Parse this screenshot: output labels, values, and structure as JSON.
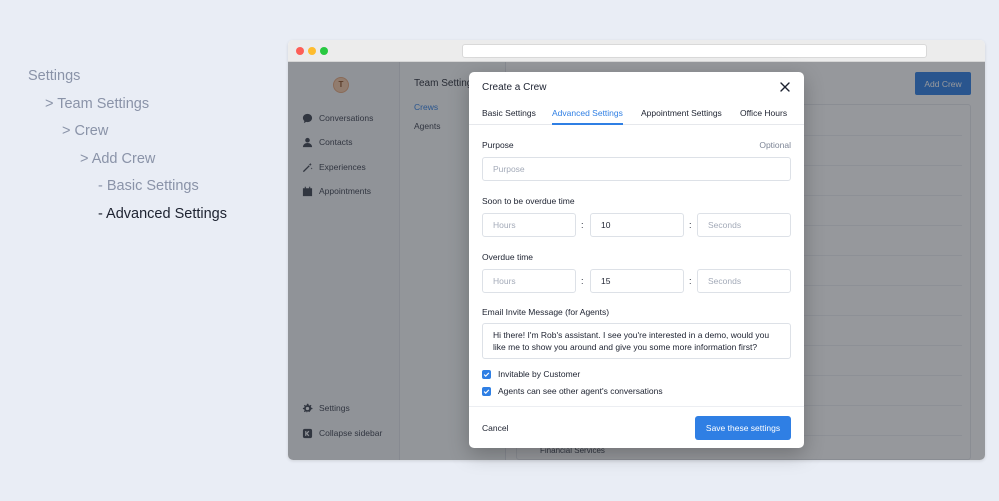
{
  "breadcrumb": {
    "items": [
      "Settings",
      "> Team Settings",
      "> Crew",
      "> Add Crew",
      "-  Basic Settings",
      "-  Advanced Settings"
    ]
  },
  "app": {
    "logo_text": "T",
    "sidebar": {
      "items": [
        {
          "label": "Conversations",
          "icon": "chat-bubble-icon"
        },
        {
          "label": "Contacts",
          "icon": "person-icon"
        },
        {
          "label": "Experiences",
          "icon": "magic-wand-icon"
        },
        {
          "label": "Appointments",
          "icon": "calendar-icon"
        }
      ],
      "bottom_items": [
        {
          "label": "Settings",
          "icon": "gear-icon"
        },
        {
          "label": "Collapse sidebar",
          "icon": "collapse-icon"
        }
      ]
    },
    "subnav": {
      "title": "Team Settings",
      "links": [
        "Crews",
        "Agents"
      ]
    },
    "main": {
      "add_button": "Add Crew",
      "last_row_text": "Financial Services"
    }
  },
  "modal": {
    "title": "Create a Crew",
    "tabs": [
      "Basic Settings",
      "Advanced Settings",
      "Appointment Settings",
      "Office Hours"
    ],
    "active_tab": "Advanced Settings",
    "purpose": {
      "label": "Purpose",
      "hint": "Optional",
      "placeholder": "Purpose",
      "value": ""
    },
    "soon_overdue": {
      "label": "Soon to be overdue time",
      "hours_placeholder": "Hours",
      "minutes_value": "10",
      "seconds_placeholder": "Seconds"
    },
    "overdue": {
      "label": "Overdue time",
      "hours_placeholder": "Hours",
      "minutes_value": "15",
      "seconds_placeholder": "Seconds"
    },
    "separator": ":",
    "email": {
      "label": "Email Invite Message (for Agents)",
      "value": "Hi there! I'm Rob's assistant. I see you're interested in a demo, would you like me to show you around and give you some more information first?"
    },
    "checkboxes": [
      {
        "label": "Invitable by Customer",
        "checked": true
      },
      {
        "label": "Agents can see other agent's conversations",
        "checked": true
      }
    ],
    "cancel_label": "Cancel",
    "save_label": "Save these settings"
  },
  "colors": {
    "accent": "#2f7fe4",
    "background": "#e9edf5"
  }
}
